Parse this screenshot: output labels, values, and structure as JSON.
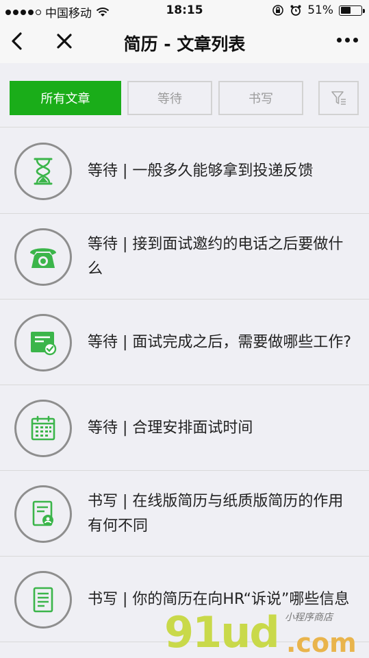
{
  "status_bar": {
    "carrier": "中国移动",
    "time": "18:15",
    "battery_percent": "51%",
    "battery_level": 0.51
  },
  "nav": {
    "title": "简历 - 文章列表",
    "back_icon": "chevron-left-icon",
    "close_icon": "close-icon",
    "more_icon": "more-dots-icon"
  },
  "filters": {
    "tabs": [
      {
        "label": "所有文章",
        "active": true
      },
      {
        "label": "等待",
        "active": false
      },
      {
        "label": "书写",
        "active": false
      }
    ],
    "filter_icon": "funnel-filter-icon"
  },
  "articles": [
    {
      "title": "等待 | 一般多久能够拿到投递反馈",
      "icon": "hourglass-icon"
    },
    {
      "title": "等待 | 接到面试邀约的电话之后要做什么",
      "icon": "telephone-icon"
    },
    {
      "title": "等待 | 面试完成之后，需要做哪些工作?",
      "icon": "task-check-icon"
    },
    {
      "title": "等待 | 合理安排面试时间",
      "icon": "calendar-icon"
    },
    {
      "title": "书写 | 在线版简历与纸质版简历的作用有何不同",
      "icon": "resume-badge-icon"
    },
    {
      "title": "书写 | 你的简历在向HR“诉说”哪些信息",
      "icon": "document-lines-icon"
    }
  ],
  "colors": {
    "accent": "#1aad19",
    "icon_green": "#3bb54a",
    "background": "#efeff4",
    "tab_border": "#d2d2d2"
  },
  "watermark": {
    "logo": "91ud",
    "suffix": ".com",
    "tagline": "小程序商店"
  }
}
